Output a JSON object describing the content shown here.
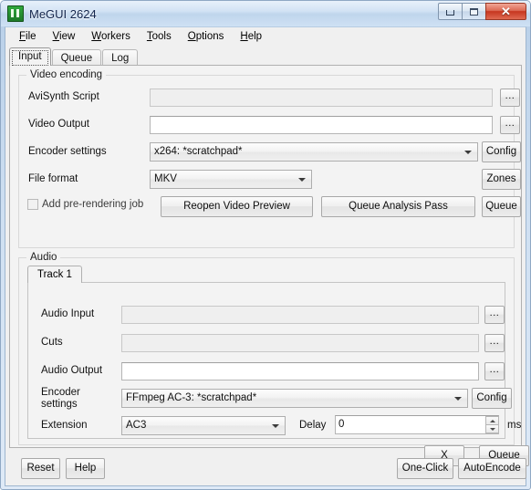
{
  "window": {
    "title": "MeGUI 2624",
    "icon": "megui-app-icon",
    "controls": {
      "minimize": "minimize-icon",
      "maximize": "maximize-icon",
      "close": "✕"
    }
  },
  "menubar": {
    "items": [
      {
        "label": "File",
        "accel": "F"
      },
      {
        "label": "View",
        "accel": "V"
      },
      {
        "label": "Workers",
        "accel": "W"
      },
      {
        "label": "Tools",
        "accel": "T"
      },
      {
        "label": "Options",
        "accel": "O"
      },
      {
        "label": "Help",
        "accel": "H"
      }
    ]
  },
  "tabs": [
    {
      "label": "Input",
      "active": true
    },
    {
      "label": "Queue",
      "active": false
    },
    {
      "label": "Log",
      "active": false
    }
  ],
  "video_group": {
    "title": "Video encoding",
    "avisynth_label": "AviSynth Script",
    "avisynth_value": "",
    "avisynth_browse": "...",
    "video_output_label": "Video Output",
    "video_output_value": "",
    "video_output_browse": "...",
    "encoder_settings_label": "Encoder settings",
    "encoder_settings_value": "x264: *scratchpad*",
    "config_button": "Config",
    "file_format_label": "File format",
    "file_format_value": "MKV",
    "zones_button": "Zones",
    "prerender_checkbox": "Add pre-rendering job",
    "prerender_checked": false,
    "reopen_preview_button": "Reopen Video Preview",
    "queue_analysis_button": "Queue Analysis Pass",
    "queue_button": "Queue"
  },
  "audio_group": {
    "title": "Audio",
    "track_tab": "Track 1",
    "audio_input_label": "Audio Input",
    "audio_input_value": "",
    "audio_input_browse": "...",
    "cuts_label": "Cuts",
    "cuts_value": "",
    "cuts_browse": "...",
    "audio_output_label": "Audio Output",
    "audio_output_value": "",
    "audio_output_browse": "...",
    "encoder_settings_label": "Encoder\nsettings",
    "encoder_settings_value": "FFmpeg AC-3: *scratchpad*",
    "config_button": "Config",
    "extension_label": "Extension",
    "extension_value": "AC3",
    "delay_label": "Delay",
    "delay_value": "0",
    "delay_units": "ms",
    "remove_button": "X",
    "queue_button": "Queue"
  },
  "bottom_bar": {
    "reset_button": "Reset",
    "help_button": "Help",
    "oneclick_button": "One-Click",
    "autoencode_button": "AutoEncode"
  },
  "colors": {
    "titlebar_start": "#e8f1fb",
    "titlebar_end": "#cfe1f4",
    "close_button": "#c6361f",
    "app_icon_green": "#2fa83c",
    "client_bg": "#f0f0f0",
    "panel_bg": "#f3f3f3"
  }
}
